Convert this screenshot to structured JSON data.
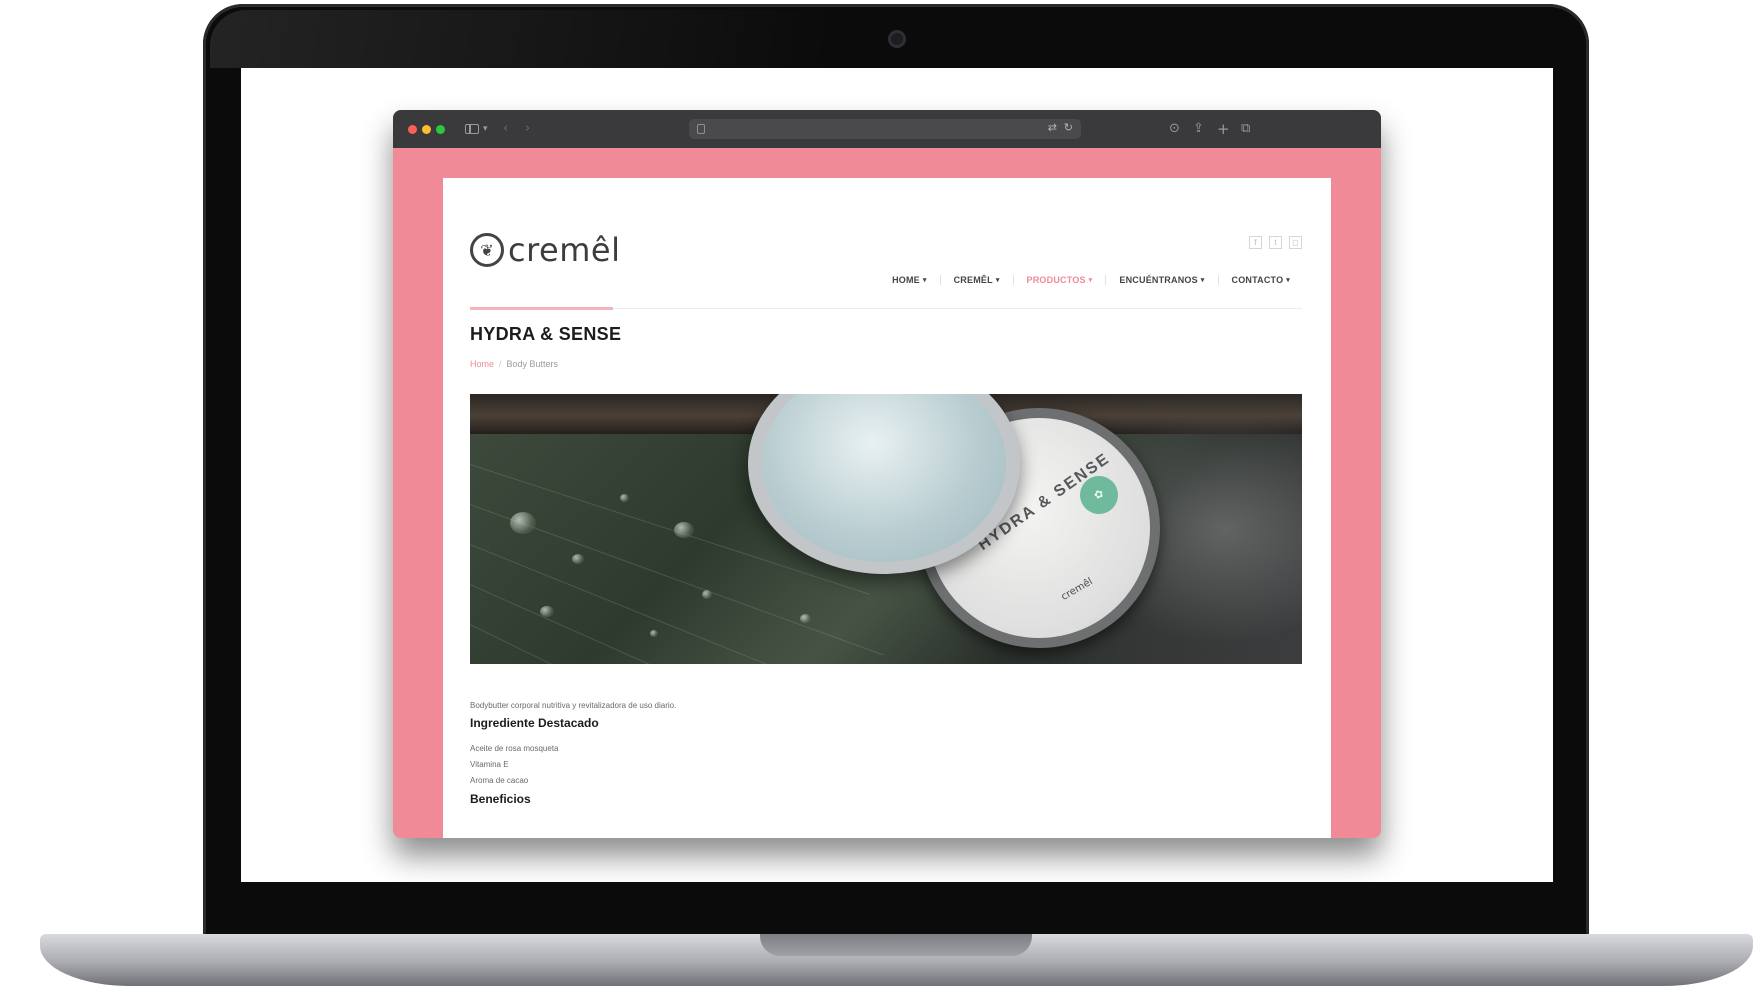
{
  "browser": {
    "url_translate_icon": "translate-icon",
    "url_reload_icon": "reload-icon"
  },
  "site": {
    "logo_text": "cremêl",
    "social_icons": [
      "facebook-icon",
      "twitter-icon",
      "instagram-icon"
    ],
    "nav": [
      {
        "label": "HOME",
        "active": false
      },
      {
        "label": "CREMÊL",
        "active": false
      },
      {
        "label": "PRODUCTOS",
        "active": true
      },
      {
        "label": "ENCUÉNTRANOS",
        "active": false
      },
      {
        "label": "CONTACTO",
        "active": false
      }
    ],
    "nav_caret": "▾",
    "accent_color": "#ef8b97",
    "frame_color": "#f08a97"
  },
  "product": {
    "title": "HYDRA & SENSE",
    "breadcrumb": {
      "home": "Home",
      "separator": "/",
      "current": "Body Butters"
    },
    "jar_label": "HYDRA & SENSE",
    "jar_brand": "cremêl",
    "description": "Bodybutter corporal nutritiva y revitalizadora de uso diario.",
    "ingredients_heading": "Ingrediente Destacado",
    "ingredients": [
      "Aceite de rosa mosqueta",
      "Vitamina E",
      "Aroma de cacao"
    ],
    "benefits_heading": "Beneficios"
  }
}
